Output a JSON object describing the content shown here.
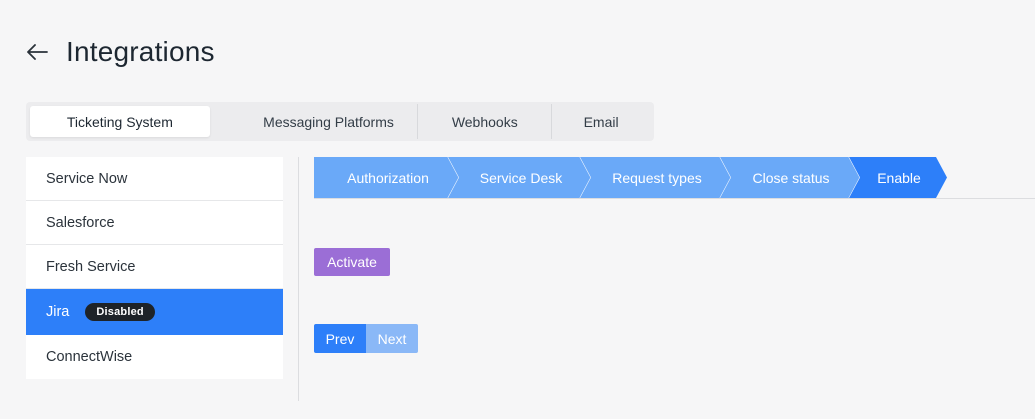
{
  "header": {
    "title": "Integrations",
    "back_icon": "arrow-left-icon"
  },
  "tabs": [
    {
      "label": "Ticketing System",
      "active": true
    },
    {
      "label": "Messaging Platforms",
      "active": false
    },
    {
      "label": "Webhooks",
      "active": false
    },
    {
      "label": "Email",
      "active": false
    }
  ],
  "sidebar": {
    "items": [
      {
        "label": "Service Now"
      },
      {
        "label": "Salesforce"
      },
      {
        "label": "Fresh Service"
      },
      {
        "label": "Jira",
        "badge": "Disabled",
        "selected": true
      },
      {
        "label": "ConnectWise"
      }
    ]
  },
  "steps": [
    {
      "label": "Authorization",
      "active": false
    },
    {
      "label": "Service Desk",
      "active": false
    },
    {
      "label": "Request types",
      "active": false
    },
    {
      "label": "Close status",
      "active": false
    },
    {
      "label": "Enable",
      "active": true
    }
  ],
  "actions": {
    "activate_label": "Activate",
    "prev_label": "Prev",
    "next_label": "Next"
  },
  "colors": {
    "primary": "#2d7ff9",
    "step_inactive": "#6aa9f8",
    "activate": "#9b6ed6",
    "badge_bg": "#1e2328"
  }
}
